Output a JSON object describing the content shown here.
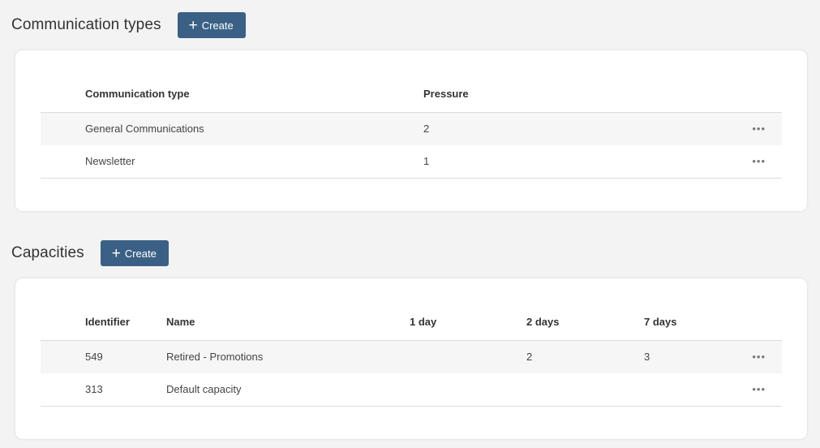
{
  "communication_types": {
    "title": "Communication types",
    "create_label": "Create",
    "columns": [
      "Communication type",
      "Pressure"
    ],
    "rows": [
      {
        "type": "General Communications",
        "pressure": "2"
      },
      {
        "type": "Newsletter",
        "pressure": "1"
      }
    ]
  },
  "capacities": {
    "title": "Capacities",
    "create_label": "Create",
    "columns": [
      "Identifier",
      "Name",
      "1 day",
      "2 days",
      "7 days"
    ],
    "rows": [
      {
        "identifier": "549",
        "name": "Retired - Promotions",
        "day1": "",
        "day2": "2",
        "day7": "3"
      },
      {
        "identifier": "313",
        "name": "Default capacity",
        "day1": "",
        "day2": "",
        "day7": ""
      }
    ]
  },
  "row_menu_icon": "more-horizontal-icon",
  "colors": {
    "accent": "#3a6185",
    "background": "#f3f3f3",
    "card": "#ffffff",
    "row_shade": "#f6f6f6"
  }
}
